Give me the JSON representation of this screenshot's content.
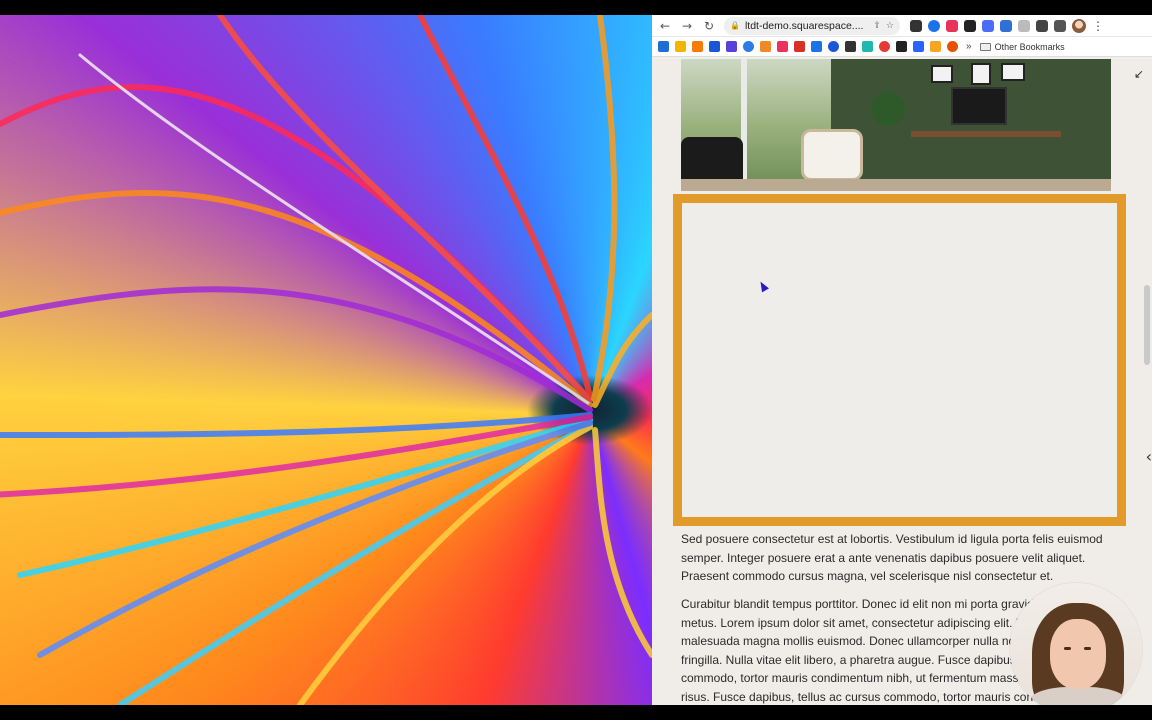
{
  "browser": {
    "url": "ltdt-demo.squarespace....",
    "bookmarks_folder": "Other Bookmarks",
    "bookmarks_more": "»",
    "nav": {
      "back": "←",
      "forward": "→",
      "reload": "↻"
    },
    "omnibox_icons": {
      "lock": "🔒",
      "share": "⇪",
      "star": "☆"
    },
    "menu": "⋮"
  },
  "page": {
    "paragraph_1": "Sed posuere consectetur est at lobortis. Vestibulum id ligula porta felis euismod semper. Integer posuere erat a ante venenatis dapibus posuere velit aliquet. Praesent commodo cursus magna, vel scelerisque nisl consectetur et.",
    "paragraph_2": "Curabitur blandit tempus porttitor. Donec id elit non mi porta gravida at eget metus. Lorem ipsum dolor sit amet, consectetur adipiscing elit. Etiam porta sem malesuada magna mollis euismod. Donec ullamcorper nulla non metus auctor fringilla. Nulla vitae elit libero, a pharetra augue. Fusce dapibus, tellus ac cursus commodo, tortor mauris condimentum nibh, ut fermentum massa justo sit amet risus. Fusce dapibus, tellus ac cursus commodo, tortor mauris condimentum nibh, ut fermentum massa",
    "frame_color": "#e29b29",
    "collapse_icon": "↙",
    "side_arrow": "‹"
  },
  "icons": {
    "extensions": [
      "grid-icon",
      "circle-icon",
      "c-icon",
      "w-icon",
      "chat-icon",
      "tab-icon",
      "doc-icon",
      "puzzle-icon",
      "sidebar-icon"
    ],
    "bookmarks": [
      "trello-icon",
      "drive-icon",
      "x-icon",
      "n-icon",
      "s-icon",
      "globe-icon",
      "flame-icon",
      "c-icon",
      "gmail-icon",
      "z-icon",
      "circle-icon",
      "kajabi-icon",
      "stack-icon",
      "m-icon",
      "refresh-icon",
      "layers-icon",
      "chart-icon",
      "apple-icon"
    ]
  }
}
